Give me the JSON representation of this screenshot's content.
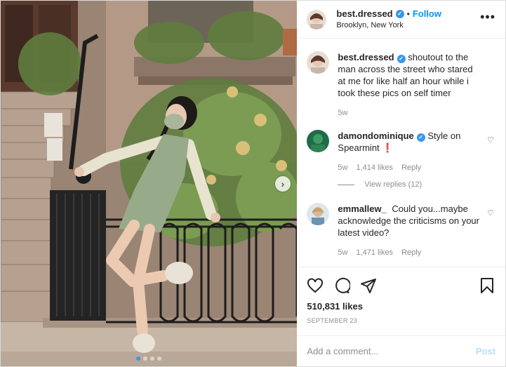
{
  "header": {
    "username": "best.dressed",
    "separator": "•",
    "follow_label": "Follow",
    "location": "Brooklyn, New York",
    "more_icon": "more-horizontal-icon"
  },
  "comments": [
    {
      "username": "best.dressed",
      "verified": true,
      "text": "shoutout to the man across the street who stared at me for like half an hour while i took these pics on self timer",
      "time": "5w"
    },
    {
      "username": "damondominique",
      "verified": true,
      "text": "Style on Spearmint ❗",
      "time": "5w",
      "likes": "1,414 likes",
      "reply_label": "Reply",
      "view_replies": "View replies (12)"
    },
    {
      "username": "emmallew_",
      "verified": false,
      "text": "Could you...maybe acknowledge the criticisms on your latest video?",
      "time": "5w",
      "likes": "1,471 likes",
      "reply_label": "Reply"
    }
  ],
  "actions": {
    "likes": "510,831 likes",
    "date": "SEPTEMBER 23"
  },
  "composer": {
    "placeholder": "Add a comment...",
    "post_label": "Post"
  },
  "carousel": {
    "next_icon": "chevron-right-icon",
    "count": 4,
    "active_index": 0
  },
  "colors": {
    "accent": "#0095f6",
    "verified": "#3897f0",
    "post_disabled": "#b2dffc"
  }
}
